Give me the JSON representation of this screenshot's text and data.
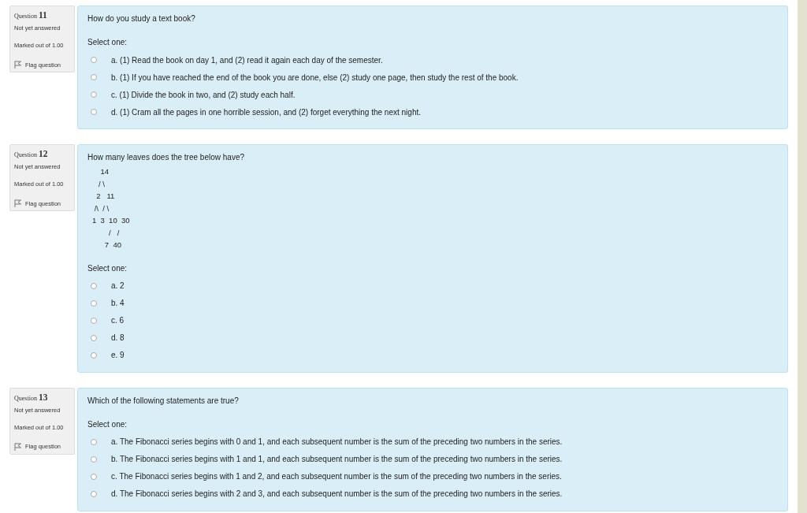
{
  "questions": [
    {
      "label": "Question",
      "number": "11",
      "status": "Not yet answered",
      "marks": "Marked out of 1.00",
      "flag": {
        "label": "Flag question",
        "flagged": false
      },
      "text": "How do you study a text book?",
      "prompt": "Select one:",
      "options": [
        {
          "label": "a. (1) Read the book on day 1, and (2) read it again each day of the semester.",
          "selected": false
        },
        {
          "label": "b. (1) If you have reached the end of the book you are done, else (2) study one page, then study the rest of the book.",
          "selected": false
        },
        {
          "label": "c. (1) Divide the book in two, and (2) study each half.",
          "selected": false
        },
        {
          "label": "d. (1) Cram all the pages in one horrible session, and (2) forget everything the next night.",
          "selected": false
        }
      ]
    },
    {
      "label": "Question",
      "number": "12",
      "status": "Not yet answered",
      "marks": "Marked out of 1.00",
      "flag": {
        "label": "Flag question",
        "flagged": false
      },
      "text": "How many leaves does the tree below have?",
      "tree": [
        "    14",
        "   / \\",
        "  2   11",
        " /\\  / \\",
        "1  3  10  30",
        "        /   /",
        "      7  40"
      ],
      "prompt": "Select one:",
      "options": [
        {
          "label": "a. 2",
          "selected": false
        },
        {
          "label": "b. 4",
          "selected": false
        },
        {
          "label": "c. 6",
          "selected": false
        },
        {
          "label": "d. 8",
          "selected": false
        },
        {
          "label": "e. 9",
          "selected": false
        }
      ]
    },
    {
      "label": "Question",
      "number": "13",
      "status": "Not yet answered",
      "marks": "Marked out of 1.00",
      "flag": {
        "label": "Flag question",
        "flagged": false
      },
      "text": "Which of the following statements are true?",
      "prompt": "Select one:",
      "options": [
        {
          "label": "a. The Fibonacci series begins with 0 and 1, and each subsequent number is the sum of the preceding two numbers in the series.",
          "selected": false
        },
        {
          "label": "b. The Fibonacci series begins with 1 and 1, and each subsequent number is the sum of the preceding two numbers in the series.",
          "selected": false
        },
        {
          "label": "c. The Fibonacci series begins with 1 and 2, and each subsequent number is the sum of the preceding two numbers in the series.",
          "selected": false
        },
        {
          "label": "d. The Fibonacci series begins with 2 and 3, and each subsequent number is the sum of the preceding two numbers in the series.",
          "selected": false
        }
      ]
    }
  ]
}
